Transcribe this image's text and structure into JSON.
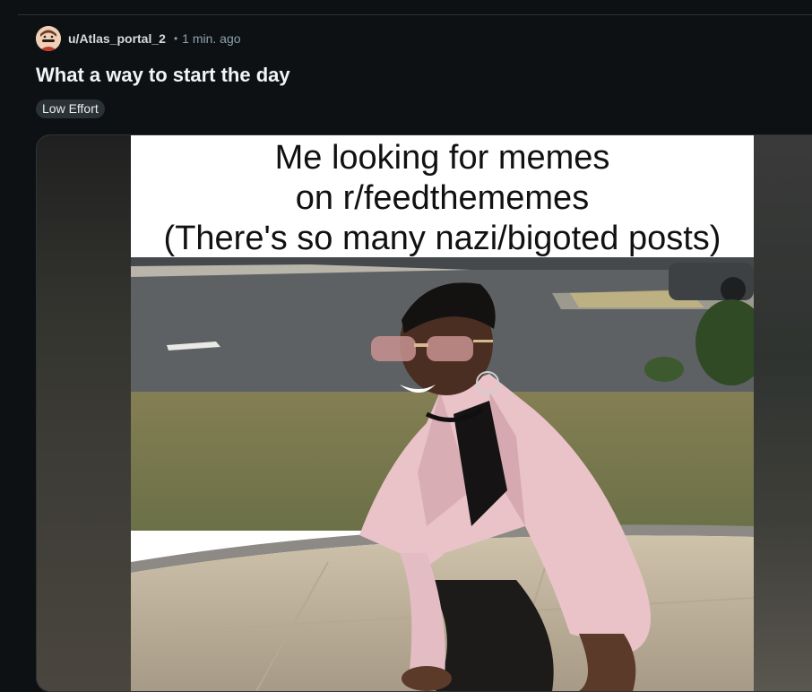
{
  "post": {
    "username": "u/Atlas_portal_2",
    "separator": "•",
    "time_ago": "1 min. ago",
    "title": "What a way to start the day",
    "flair": "Low Effort",
    "avatar_icon": "user-avatar-icon"
  },
  "meme": {
    "caption_lines": [
      "Me looking for memes",
      "on r/feedthememes",
      "(There's so many nazi/bigoted posts)"
    ]
  },
  "colors": {
    "background": "#0e1113",
    "meta_text": "#8ba2ad",
    "flair_bg": "#2a3236"
  }
}
